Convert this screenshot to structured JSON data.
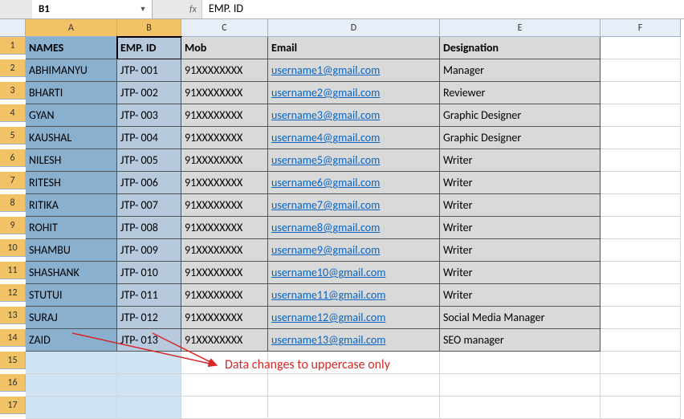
{
  "formula_bar": {
    "name_box": "B1",
    "fx_label": "fx",
    "formula": "EMP. ID"
  },
  "columns": [
    "A",
    "B",
    "C",
    "D",
    "E",
    "F"
  ],
  "rows": [
    "1",
    "2",
    "3",
    "4",
    "5",
    "6",
    "7",
    "8",
    "9",
    "10",
    "11",
    "12",
    "13",
    "14",
    "15",
    "16",
    "17"
  ],
  "headers": {
    "A": "NAMES",
    "B": "EMP. ID",
    "C": "Mob",
    "D": "Email",
    "E": "Designation"
  },
  "data": [
    {
      "name": "ABHIMANYU",
      "emp": "JTP- 001",
      "mob": "91XXXXXXXX",
      "email": "username1@gmail.com",
      "des": "Manager"
    },
    {
      "name": "BHARTI",
      "emp": "JTP- 002",
      "mob": "91XXXXXXXX",
      "email": "username2@gmail.com",
      "des": "Reviewer"
    },
    {
      "name": "GYAN",
      "emp": "JTP- 003",
      "mob": "91XXXXXXXX",
      "email": "username3@gmail.com",
      "des": "Graphic Designer"
    },
    {
      "name": "KAUSHAL",
      "emp": "JTP- 004",
      "mob": "91XXXXXXXX",
      "email": "username4@gmail.com",
      "des": "Graphic Designer"
    },
    {
      "name": "NILESH",
      "emp": "JTP- 005",
      "mob": "91XXXXXXXX",
      "email": "username5@gmail.com",
      "des": "Writer"
    },
    {
      "name": "RITESH",
      "emp": "JTP- 006",
      "mob": "91XXXXXXXX",
      "email": "username6@gmail.com",
      "des": "Writer"
    },
    {
      "name": "RITIKA",
      "emp": "JTP- 007",
      "mob": "91XXXXXXXX",
      "email": "username7@gmail.com",
      "des": "Writer"
    },
    {
      "name": "ROHIT",
      "emp": "JTP- 008",
      "mob": "91XXXXXXXX",
      "email": "username8@gmail.com",
      "des": "Writer"
    },
    {
      "name": "SHAMBU",
      "emp": "JTP- 009",
      "mob": "91XXXXXXXX",
      "email": "username9@gmail.com",
      "des": "Writer"
    },
    {
      "name": "SHASHANK",
      "emp": "JTP- 010",
      "mob": "91XXXXXXXX",
      "email": "username10@gmail.com",
      "des": "Writer"
    },
    {
      "name": "STUTUI",
      "emp": "JTP- 011",
      "mob": "91XXXXXXXX",
      "email": "username11@gmail.com",
      "des": "Writer"
    },
    {
      "name": "SURAJ",
      "emp": "JTP- 012",
      "mob": "91XXXXXXXX",
      "email": "username12@gmail.com",
      "des": "Social Media Manager"
    },
    {
      "name": "ZAID",
      "emp": "JTP- 013",
      "mob": "91XXXXXXXX",
      "email": "username13@gmail.com",
      "des": "SEO manager"
    }
  ],
  "annotation": "Data changes to uppercase only",
  "colors": {
    "selection_a": "#8ab0d0",
    "selection_b": "#b7c9dc",
    "data_bg": "#d9d9d9",
    "annotation": "#d62828"
  }
}
